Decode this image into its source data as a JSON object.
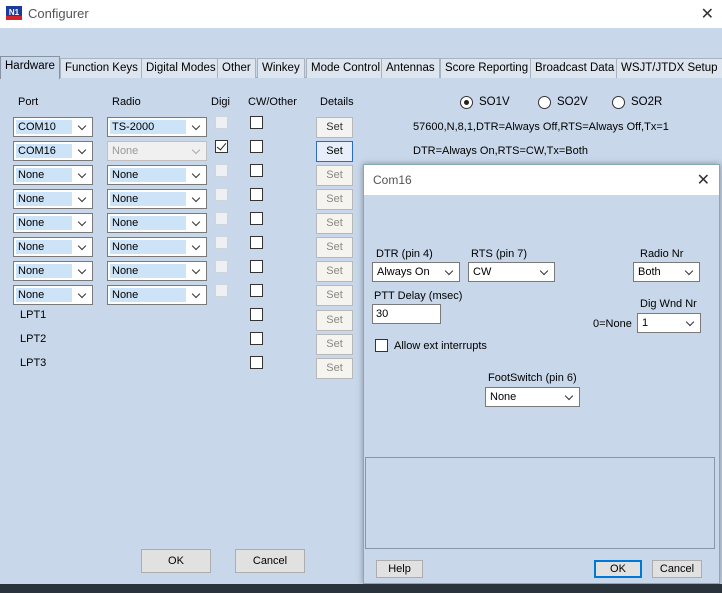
{
  "window": {
    "title": "Configurer",
    "logo": "N1"
  },
  "tabs": [
    "Hardware",
    "Function Keys",
    "Digital Modes",
    "Other",
    "Winkey",
    "Mode Control",
    "Antennas",
    "Score Reporting",
    "Broadcast Data",
    "WSJT/JTDX Setup"
  ],
  "headers": {
    "port": "Port",
    "radio": "Radio",
    "digi": "Digi",
    "cw_other": "CW/Other",
    "details": "Details"
  },
  "rows": [
    {
      "port": "COM10",
      "radio": "TS-2000",
      "digi": false,
      "cw": false
    },
    {
      "port": "COM16",
      "radio": "None",
      "digi": true,
      "cw": false
    },
    {
      "port": "None",
      "radio": "None",
      "digi": false,
      "cw": false
    },
    {
      "port": "None",
      "radio": "None",
      "digi": false,
      "cw": false
    },
    {
      "port": "None",
      "radio": "None",
      "digi": false,
      "cw": false
    },
    {
      "port": "None",
      "radio": "None",
      "digi": false,
      "cw": false
    },
    {
      "port": "None",
      "radio": "None",
      "digi": false,
      "cw": false
    },
    {
      "port": "None",
      "radio": "None",
      "digi": false,
      "cw": false
    }
  ],
  "lpt": [
    "LPT1",
    "LPT2",
    "LPT3"
  ],
  "set_label": "Set",
  "so_options": [
    {
      "label": "SO1V",
      "selected": true
    },
    {
      "label": "SO2V",
      "selected": false
    },
    {
      "label": "SO2R",
      "selected": false
    }
  ],
  "info": {
    "line1": "57600,N,8,1,DTR=Always Off,RTS=Always Off,Tx=1",
    "line2": "DTR=Always On,RTS=CW,Tx=Both"
  },
  "main_buttons": {
    "ok": "OK",
    "cancel": "Cancel"
  },
  "dialog": {
    "title": "Com16",
    "dtr_label": "DTR (pin 4)",
    "dtr_value": "Always On",
    "rts_label": "RTS (pin 7)",
    "rts_value": "CW",
    "radio_nr_label": "Radio Nr",
    "radio_nr_value": "Both",
    "ptt_label": "PTT Delay  (msec)",
    "ptt_value": "30",
    "dig_wnd_label": "Dig Wnd Nr",
    "dig_wnd_prefix": "0=None",
    "dig_wnd_value": "1",
    "allow_ext": "Allow ext interrupts",
    "footswitch_label": "FootSwitch (pin 6)",
    "footswitch_value": "None",
    "help": "Help",
    "ok": "OK",
    "cancel": "Cancel"
  }
}
